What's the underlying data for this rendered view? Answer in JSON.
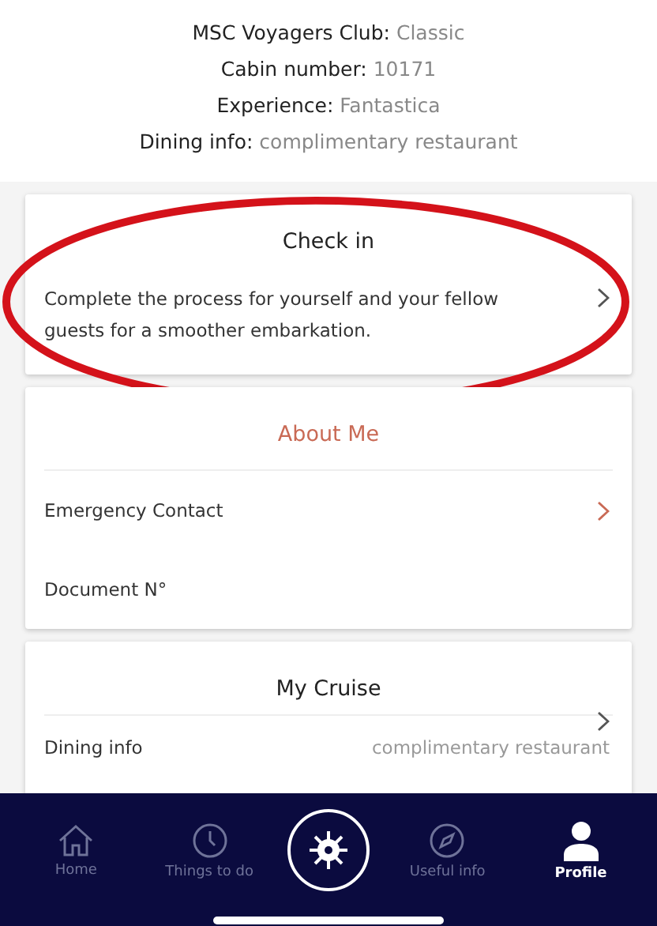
{
  "profile_info": [
    {
      "label": "MSC Voyagers Club:",
      "value": "Classic"
    },
    {
      "label": "Cabin number:",
      "value": "10171"
    },
    {
      "label": "Experience:",
      "value": "Fantastica"
    },
    {
      "label": "Dining info:",
      "value": "complimentary restaurant"
    }
  ],
  "check_in": {
    "title": "Check in",
    "description": "Complete the process for yourself and your fellow guests for a smoother embarkation.",
    "annotation": {
      "kind": "ellipse"
    }
  },
  "about_me": {
    "title": "About Me",
    "rows": [
      {
        "label": "Emergency Contact",
        "chevron": true
      },
      {
        "label": "Document N°",
        "chevron": false
      }
    ]
  },
  "my_cruise": {
    "title": "My Cruise",
    "rows": [
      {
        "label": "Dining info",
        "value": "complimentary restaurant"
      }
    ]
  },
  "tab_bar": [
    {
      "kind": "home",
      "label": "Home",
      "selected": false
    },
    {
      "kind": "clock",
      "label": "Things to do",
      "selected": false
    },
    {
      "kind": "center",
      "selected": false
    },
    {
      "kind": "compass",
      "label": "Useful info",
      "selected": false
    },
    {
      "kind": "person",
      "label": "Profile",
      "selected": true
    }
  ]
}
